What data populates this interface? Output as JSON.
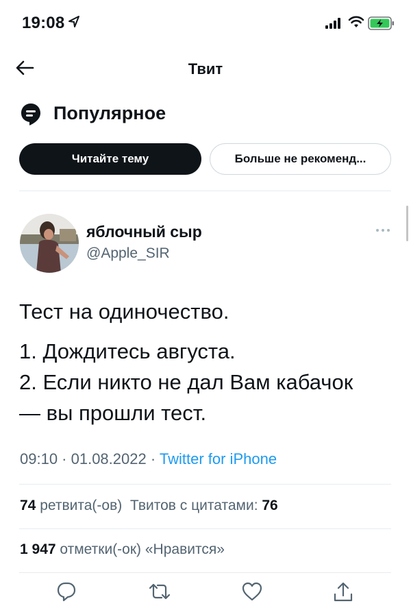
{
  "status": {
    "time": "19:08"
  },
  "nav": {
    "title": "Твит"
  },
  "topic": {
    "title": "Популярное"
  },
  "buttons": {
    "read_thread": "Читайте тему",
    "not_recommend": "Больше не рекоменд..."
  },
  "tweet": {
    "author_name": "яблочный сыр",
    "handle": "@Apple_SIR",
    "lines": [
      "Тест на одиночество.",
      "1. Дождитесь августа.",
      "2. Если никто не дал Вам кабачок",
      "— вы прошли тест."
    ],
    "time": "09:10 · 01.08.2022 · ",
    "source": "Twitter for iPhone",
    "retweets": "74",
    "retweets_label": " ретвита(-ов)",
    "quotes_label": "Твитов с цитатами: ",
    "quotes": "76",
    "likes": "1 947",
    "likes_label": " отметки(-ок) «Нравится»"
  },
  "icons": [
    "location-arrow-icon",
    "signal-icon",
    "wifi-icon",
    "battery-charging-icon",
    "back-arrow-icon",
    "topic-icon",
    "more-icon",
    "reply-icon",
    "retweet-icon",
    "like-icon",
    "share-icon"
  ],
  "colors": {
    "accent": "#1d9bf0",
    "text": "#0f1419",
    "secondary": "#536471",
    "battery": "#34c759"
  }
}
